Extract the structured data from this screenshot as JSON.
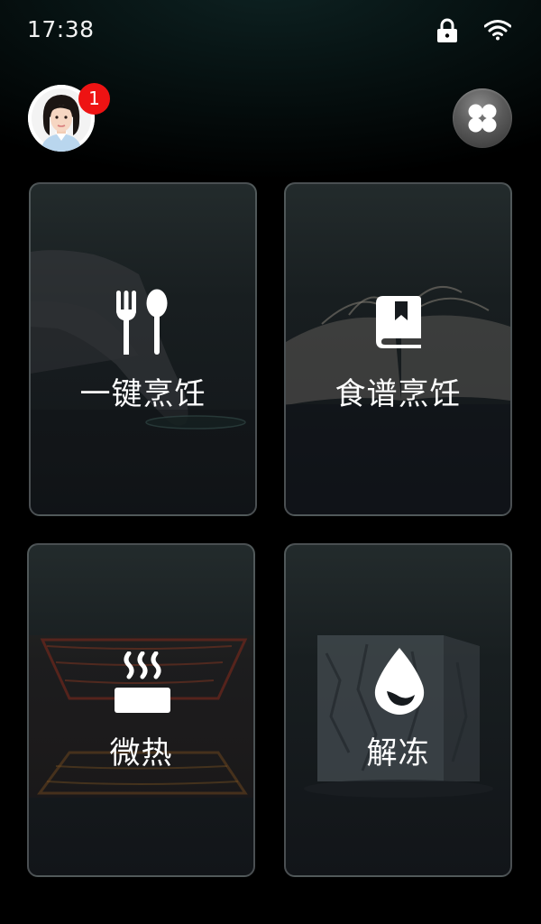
{
  "status_bar": {
    "time": "17:38",
    "icons": [
      "lock-icon",
      "wifi-icon"
    ]
  },
  "header": {
    "avatar": "avatar",
    "notification_count": "1",
    "apps_icon": "grid-apps-icon",
    "badge_color": "#ee1313"
  },
  "cards": [
    {
      "label": "一键烹饪",
      "icon": "fork-spoon-icon"
    },
    {
      "label": "食谱烹饪",
      "icon": "recipe-book-icon"
    },
    {
      "label": "微热",
      "icon": "steam-heat-icon"
    },
    {
      "label": "解冻",
      "icon": "water-drop-icon"
    }
  ]
}
